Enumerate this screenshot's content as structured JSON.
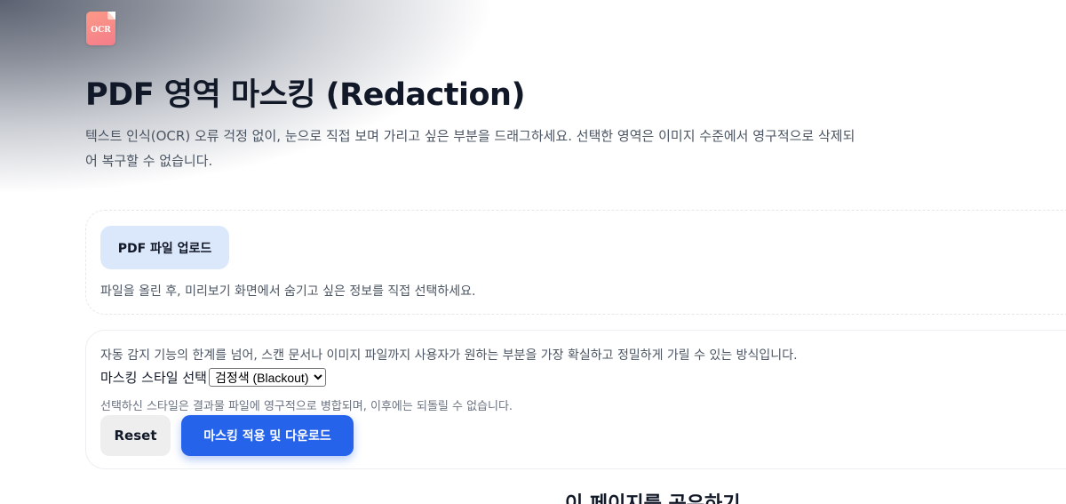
{
  "logo": {
    "text": "OCR",
    "colors": [
      "#fb9a87",
      "#f47d8a"
    ]
  },
  "header": {
    "title": "PDF 영역 마스킹 (Redaction)",
    "subtitle": "텍스트 인식(OCR) 오류 걱정 없이, 눈으로 직접 보며 가리고 싶은 부분을 드래그하세요. 선택한 영역은 이미지 수준에서 영구적으로 삭제되어 복구할 수 없습니다."
  },
  "upload": {
    "button_label": "PDF 파일 업로드",
    "hint": "파일을 올린 후, 미리보기 화면에서 숨기고 싶은 정보를 직접 선택하세요."
  },
  "settings": {
    "description": "자동 감지 기능의 한계를 넘어, 스캔 문서나 이미지 파일까지 사용자가 원하는 부분을 가장 확실하고 정밀하게 가릴 수 있는 방식입니다.",
    "style_label": "마스킹 스타일 선택",
    "style_selected": "검정색 (Blackout)",
    "note": "선택하신 스타일은 결과물 파일에 영구적으로 병합되며, 이후에는 되돌릴 수 없습니다.",
    "reset_label": "Reset",
    "apply_label": "마스킹 적용 및 다운로드"
  },
  "share": {
    "heading": "이 페이지를 공유하기"
  },
  "colors": {
    "accent": "#2563eb",
    "upload_button_bg": "#dbe7fb",
    "reset_button_bg": "#eeeeee"
  }
}
